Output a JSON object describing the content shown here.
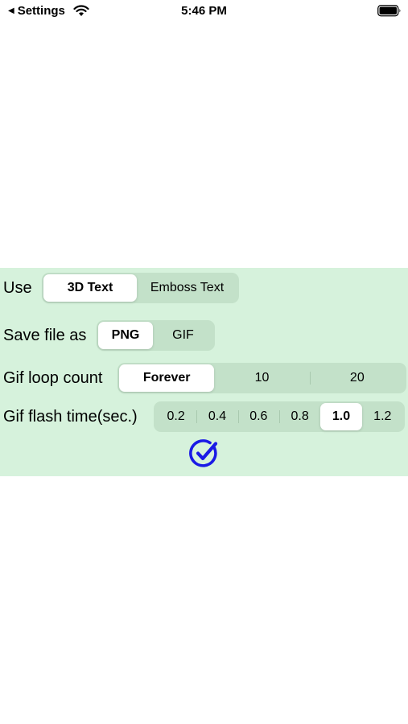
{
  "status_bar": {
    "back_label": "Settings",
    "time": "5:46 PM"
  },
  "options": {
    "use": {
      "label": "Use",
      "segments": [
        "3D Text",
        "Emboss Text"
      ],
      "selected_index": 0
    },
    "save_file": {
      "label": "Save file as",
      "segments": [
        "PNG",
        "GIF"
      ],
      "selected_index": 0
    },
    "loop_count": {
      "label": "Gif loop count",
      "segments": [
        "Forever",
        "10",
        "20"
      ],
      "selected_index": 0
    },
    "flash_time": {
      "label": "Gif flash time(sec.)",
      "segments": [
        "0.2",
        "0.4",
        "0.6",
        "0.8",
        "1.0",
        "1.2"
      ],
      "selected_index": 4
    }
  },
  "confirm_icon": "checkmark-circle-icon",
  "colors": {
    "panel_bg": "#d6f2dc",
    "segment_bg": "#c3e1c9",
    "accent": "#1a1ae6"
  }
}
